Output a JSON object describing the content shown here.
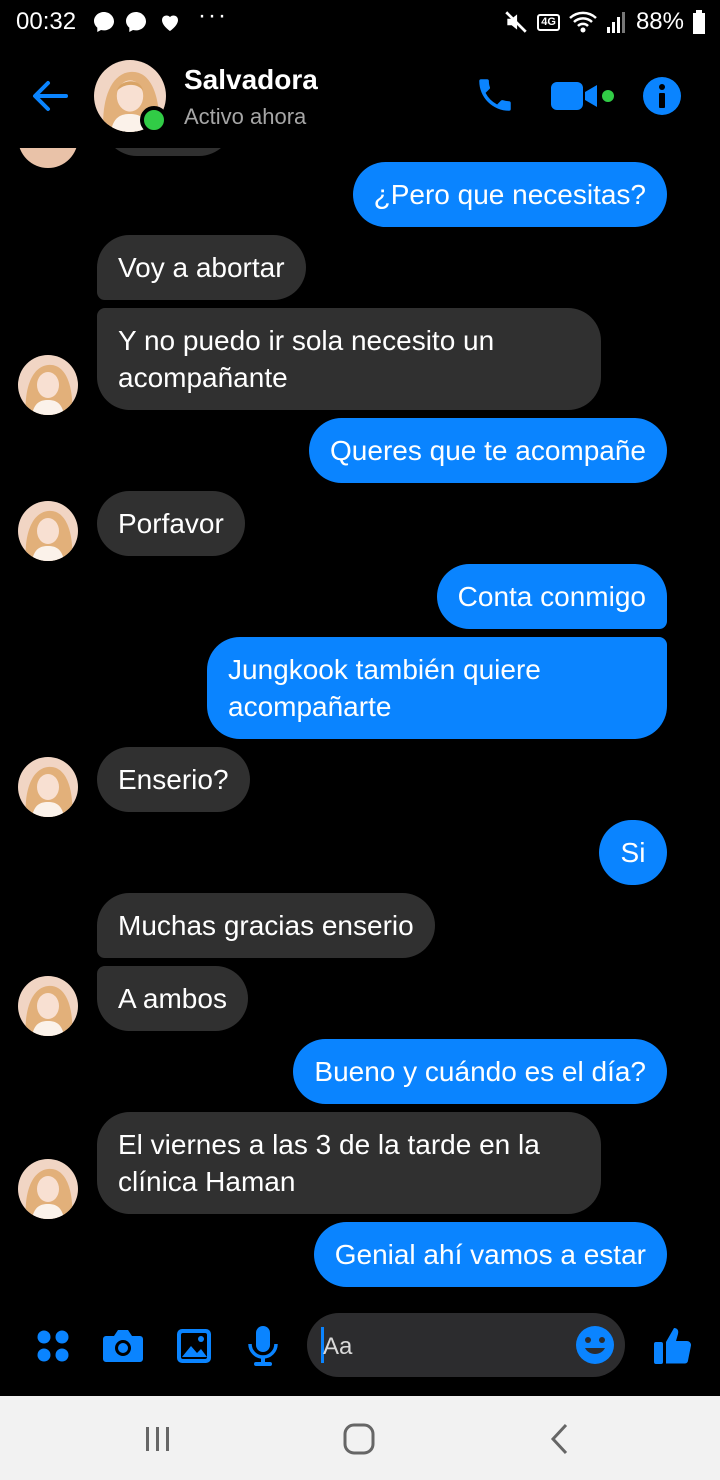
{
  "status_bar": {
    "time": "00:32",
    "dots": "···",
    "battery": "88%",
    "network": "4G"
  },
  "header": {
    "name": "Salvadora",
    "status": "Activo ahora"
  },
  "messages": [
    {
      "dir": "out",
      "text": "¿Pero que necesitas?"
    },
    {
      "dir": "in",
      "text": "Voy a abortar"
    },
    {
      "dir": "in",
      "text": "Y no puedo ir sola necesito un acompañante"
    },
    {
      "dir": "out",
      "text": "Queres que te acompañe"
    },
    {
      "dir": "in",
      "text": "Porfavor"
    },
    {
      "dir": "out",
      "text": "Conta conmigo"
    },
    {
      "dir": "out",
      "text": "Jungkook también quiere acompañarte"
    },
    {
      "dir": "in",
      "text": "Enserio?"
    },
    {
      "dir": "out",
      "text": "Si"
    },
    {
      "dir": "in",
      "text": "Muchas gracias enserio"
    },
    {
      "dir": "in",
      "text": "A ambos"
    },
    {
      "dir": "out",
      "text": "Bueno y cuándo es el día?"
    },
    {
      "dir": "in",
      "text": "El viernes a las 3 de la tarde en la clínica Haman"
    },
    {
      "dir": "out",
      "text": "Genial ahí vamos a estar"
    }
  ],
  "composer": {
    "placeholder": "Aa"
  },
  "colors": {
    "accent": "#0a84ff",
    "incoming": "#303030",
    "active": "#31cc46"
  }
}
